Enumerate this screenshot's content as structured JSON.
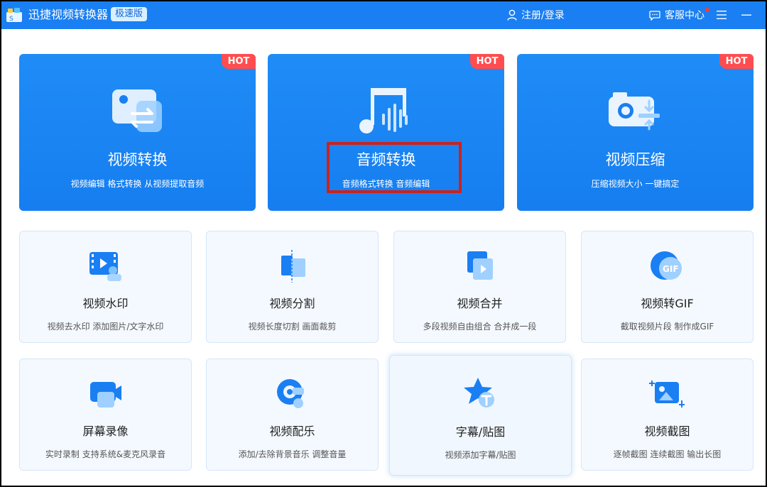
{
  "header": {
    "app_title": "迅捷视频转换器",
    "edition_badge": "极速版",
    "login_label": "注册/登录",
    "service_label": "客服中心"
  },
  "colors": {
    "brand_blue": "#1a7ff2",
    "card_bg_light": "#f4f9ff",
    "hot_red": "#ff4d4f",
    "highlight_red": "#c9231f"
  },
  "main_features": [
    {
      "badge": "HOT",
      "title": "视频转换",
      "desc": "视频编辑 格式转换 从视频提取音频",
      "icon": "video-convert-icon"
    },
    {
      "badge": "HOT",
      "title": "音频转换",
      "desc": "音频格式转换 音频编辑",
      "icon": "music-note-icon"
    },
    {
      "badge": "HOT",
      "title": "视频压缩",
      "desc": "压缩视频大小 一键搞定",
      "icon": "camera-compress-icon"
    }
  ],
  "tools": [
    {
      "title": "视频水印",
      "desc": "视频去水印 添加图片/文字水印",
      "icon": "watermark-icon"
    },
    {
      "title": "视频分割",
      "desc": "视频长度切割 画面裁剪",
      "icon": "split-icon"
    },
    {
      "title": "视频合并",
      "desc": "多段视频自由组合 合并成一段",
      "icon": "merge-icon"
    },
    {
      "title": "视频转GIF",
      "desc": "截取视频片段 制作成GIF",
      "icon": "gif-icon",
      "icon_text": "GIF"
    },
    {
      "title": "屏幕录像",
      "desc": "实时录制 支持系统&麦克风录音",
      "icon": "screen-record-icon"
    },
    {
      "title": "视频配乐",
      "desc": "添加/去除背景音乐 调整音量",
      "icon": "music-disc-icon"
    },
    {
      "title": "字幕/贴图",
      "desc": "视频添加字幕/贴图",
      "icon": "subtitle-star-icon"
    },
    {
      "title": "视频截图",
      "desc": "逐帧截图 连续截图 输出长图",
      "icon": "screenshot-icon"
    }
  ]
}
